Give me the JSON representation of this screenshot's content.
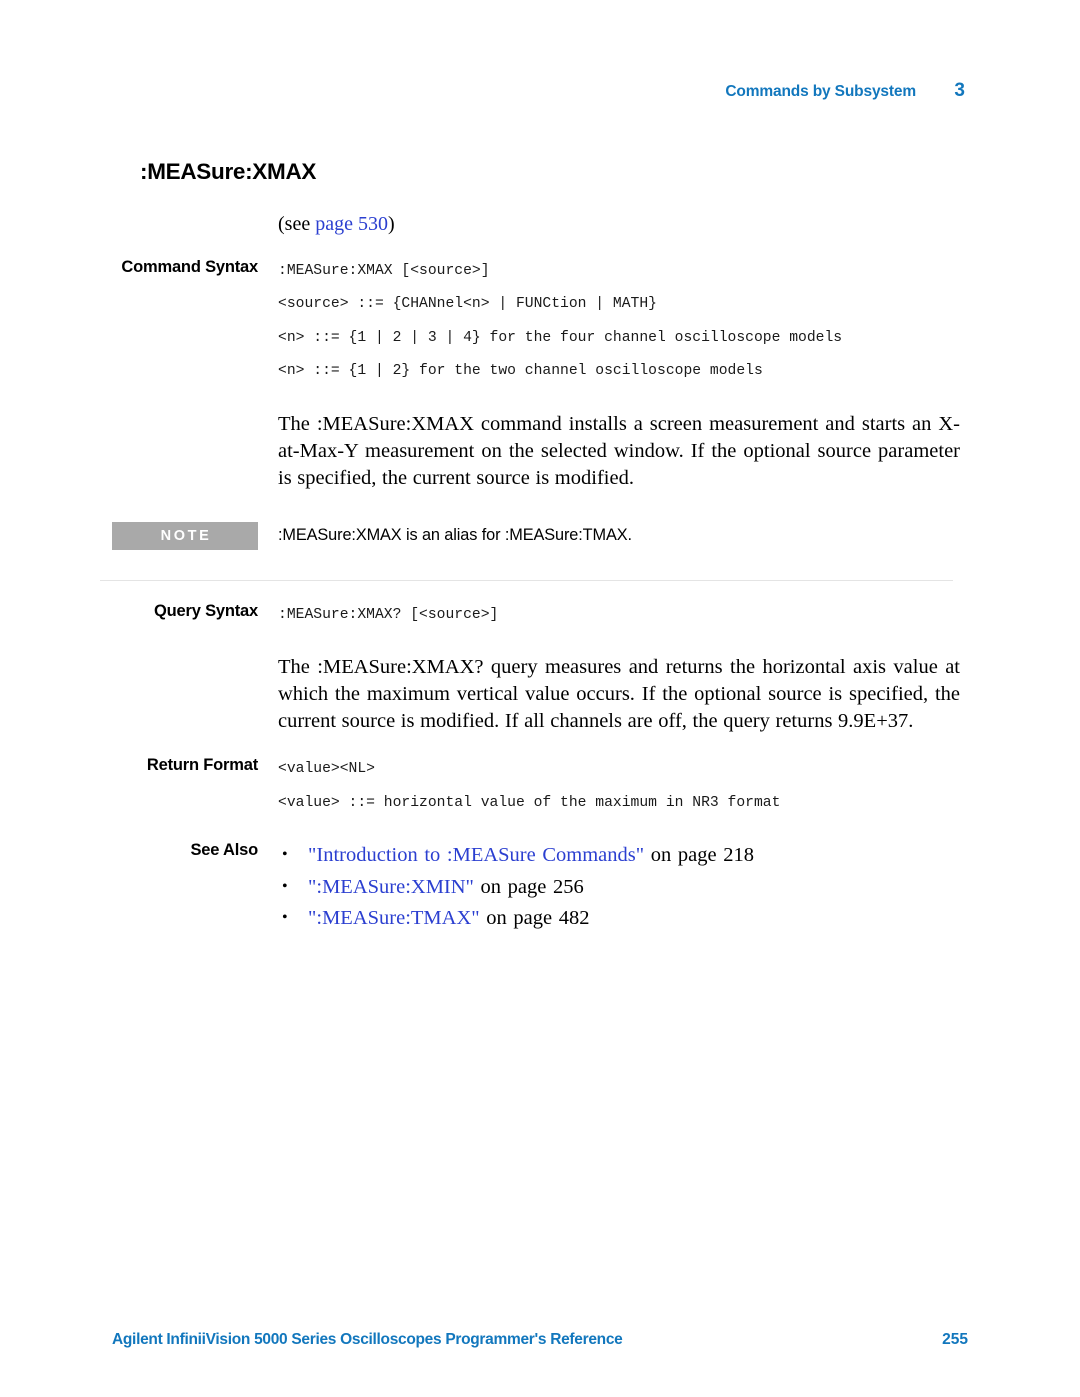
{
  "header": {
    "title": "Commands by Subsystem",
    "chapter": "3"
  },
  "command": {
    "title": ":MEASure:XMAX",
    "see_prefix": "(see ",
    "see_link": "page 530",
    "see_suffix": ")"
  },
  "command_syntax": {
    "label": "Command Syntax",
    "lines": [
      ":MEASure:XMAX [<source>]",
      "<source> ::= {CHANnel<n> | FUNCtion | MATH}",
      "<n> ::= {1 | 2 | 3 | 4} for the four channel oscilloscope models",
      "<n> ::= {1 | 2} for the two channel oscilloscope models"
    ],
    "description": "The :MEASure:XMAX command installs a screen measurement and starts an X-at-Max-Y measurement on the selected window. If the optional source parameter is specified, the current source is modified."
  },
  "note": {
    "badge": "NOTE",
    "text": ":MEASure:XMAX is an alias for :MEASure:TMAX."
  },
  "query_syntax": {
    "label": "Query Syntax",
    "lines": [
      ":MEASure:XMAX? [<source>]"
    ],
    "description": "The :MEASure:XMAX? query measures and returns the horizontal axis value at which the maximum vertical value occurs. If the optional source is specified, the current source is modified. If all channels are off, the query returns 9.9E+37."
  },
  "return_format": {
    "label": "Return Format",
    "lines": [
      "<value><NL>",
      "<value> ::= horizontal value of the maximum in NR3 format"
    ]
  },
  "see_also": {
    "label": "See Also",
    "items": [
      {
        "link": "\"Introduction to :MEASure Commands\"",
        "rest": " on page 218"
      },
      {
        "link": "\":MEASure:XMIN\"",
        "rest": " on page 256"
      },
      {
        "link": "\":MEASure:TMAX\"",
        "rest": " on page 482"
      }
    ]
  },
  "footer": {
    "text": "Agilent InfiniiVision 5000 Series Oscilloscopes Programmer's Reference",
    "page": "255"
  },
  "colors": {
    "header_blue": "#1277bd",
    "link_blue": "#2b3fd0",
    "note_gray": "#a9a9a9",
    "divider": "#e4e4e4"
  }
}
